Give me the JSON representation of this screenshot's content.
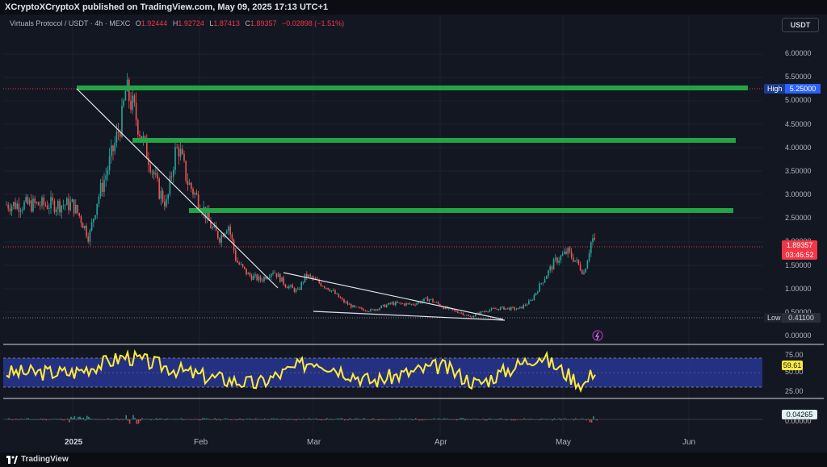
{
  "header": {
    "publisher": "XCryptoXCryptoX published on TradingView.com, May 09, 2025 17:13 UTC+1"
  },
  "legend": {
    "symbol": "Virtuals Protocol / USDT · 4h · MEXC",
    "o_label": "O",
    "open": "1.92444",
    "h_label": "H",
    "high": "1.92724",
    "l_label": "L",
    "low": "1.87413",
    "c_label": "C",
    "close": "1.89357",
    "change": "−0.02898 (−1.51%)"
  },
  "currency_button": "USDT",
  "price_axis": {
    "ticks": [
      "6.00000",
      "5.50000",
      "5.00000",
      "4.50000",
      "4.00000",
      "3.50000",
      "3.00000",
      "2.50000",
      "2.00000",
      "1.50000",
      "1.00000",
      "0.50000",
      "0.00000"
    ]
  },
  "tags": {
    "high_label": "High",
    "high_value": "5.25000",
    "low_label": "Low",
    "low_value": "0.41100",
    "price_value": "1.89357",
    "countdown": "03:46:52"
  },
  "rsi": {
    "ticks": [
      "75.00",
      "50.00",
      "25.00"
    ],
    "value": "59.61"
  },
  "osc": {
    "value": "0.04265",
    "zero_tick": "0.00000"
  },
  "time_axis": {
    "labels": [
      "2025",
      "Feb",
      "Mar",
      "Apr",
      "May",
      "Jun"
    ]
  },
  "footer": {
    "brand": "TradingView"
  },
  "colors": {
    "up": "#26a69a",
    "down": "#ef5350",
    "level": "#22a447",
    "rsi_line": "#ffeb3b",
    "rsi_band": "#283593"
  },
  "chart_data": {
    "type": "candlestick",
    "price_series": [
      [
        "2025-01-01",
        2.8
      ],
      [
        "2025-01-03",
        2.5
      ],
      [
        "2025-01-05",
        2.1
      ],
      [
        "2025-01-07",
        2.9
      ],
      [
        "2025-01-09",
        3.4
      ],
      [
        "2025-01-11",
        4.0
      ],
      [
        "2025-01-13",
        4.6
      ],
      [
        "2025-01-14",
        5.25
      ],
      [
        "2025-01-16",
        4.8
      ],
      [
        "2025-01-18",
        4.2
      ],
      [
        "2025-01-20",
        3.7
      ],
      [
        "2025-01-22",
        3.1
      ],
      [
        "2025-01-24",
        2.8
      ],
      [
        "2025-01-26",
        3.9
      ],
      [
        "2025-01-27",
        4.0
      ],
      [
        "2025-01-29",
        3.3
      ],
      [
        "2025-01-31",
        3.0
      ],
      [
        "2025-02-02",
        2.7
      ],
      [
        "2025-02-04",
        2.3
      ],
      [
        "2025-02-06",
        2.1
      ],
      [
        "2025-02-08",
        2.4
      ],
      [
        "2025-02-10",
        1.6
      ],
      [
        "2025-02-13",
        1.3
      ],
      [
        "2025-02-16",
        1.2
      ],
      [
        "2025-02-19",
        1.4
      ],
      [
        "2025-02-22",
        1.1
      ],
      [
        "2025-02-25",
        0.95
      ],
      [
        "2025-02-27",
        1.3
      ],
      [
        "2025-03-02",
        1.15
      ],
      [
        "2025-03-05",
        1.0
      ],
      [
        "2025-03-08",
        0.75
      ],
      [
        "2025-03-11",
        0.6
      ],
      [
        "2025-03-15",
        0.55
      ],
      [
        "2025-03-20",
        0.7
      ],
      [
        "2025-03-25",
        0.68
      ],
      [
        "2025-03-29",
        0.8
      ],
      [
        "2025-04-02",
        0.6
      ],
      [
        "2025-04-06",
        0.5
      ],
      [
        "2025-04-08",
        0.41
      ],
      [
        "2025-04-12",
        0.55
      ],
      [
        "2025-04-16",
        0.6
      ],
      [
        "2025-04-20",
        0.58
      ],
      [
        "2025-04-23",
        0.75
      ],
      [
        "2025-04-26",
        1.2
      ],
      [
        "2025-04-29",
        1.6
      ],
      [
        "2025-05-02",
        1.8
      ],
      [
        "2025-05-04",
        1.6
      ],
      [
        "2025-05-06",
        1.35
      ],
      [
        "2025-05-08",
        2.1
      ],
      [
        "2025-05-09",
        1.89
      ]
    ],
    "horizontal_levels": [
      5.25,
      4.15,
      2.68
    ],
    "trendlines": [
      {
        "from": [
          "2025-01-14",
          5.25
        ],
        "to": [
          "2025-02-25",
          1.0
        ]
      },
      {
        "from": [
          "2025-02-27",
          1.32
        ],
        "to": [
          "2025-04-13",
          0.42
        ]
      },
      {
        "from": [
          "2025-03-02",
          0.57
        ],
        "to": [
          "2025-04-13",
          0.4
        ]
      }
    ],
    "y_range": [
      0,
      6.5
    ],
    "rsi_series": [
      [
        "2025-01-01",
        50
      ],
      [
        "2025-01-14",
        78
      ],
      [
        "2025-02-01",
        45
      ],
      [
        "2025-02-15",
        30
      ],
      [
        "2025-03-01",
        72
      ],
      [
        "2025-03-15",
        35
      ],
      [
        "2025-04-01",
        62
      ],
      [
        "2025-04-10",
        30
      ],
      [
        "2025-04-25",
        80
      ],
      [
        "2025-05-06",
        28
      ],
      [
        "2025-05-09",
        59.61
      ]
    ],
    "rsi_range": [
      0,
      100
    ]
  }
}
